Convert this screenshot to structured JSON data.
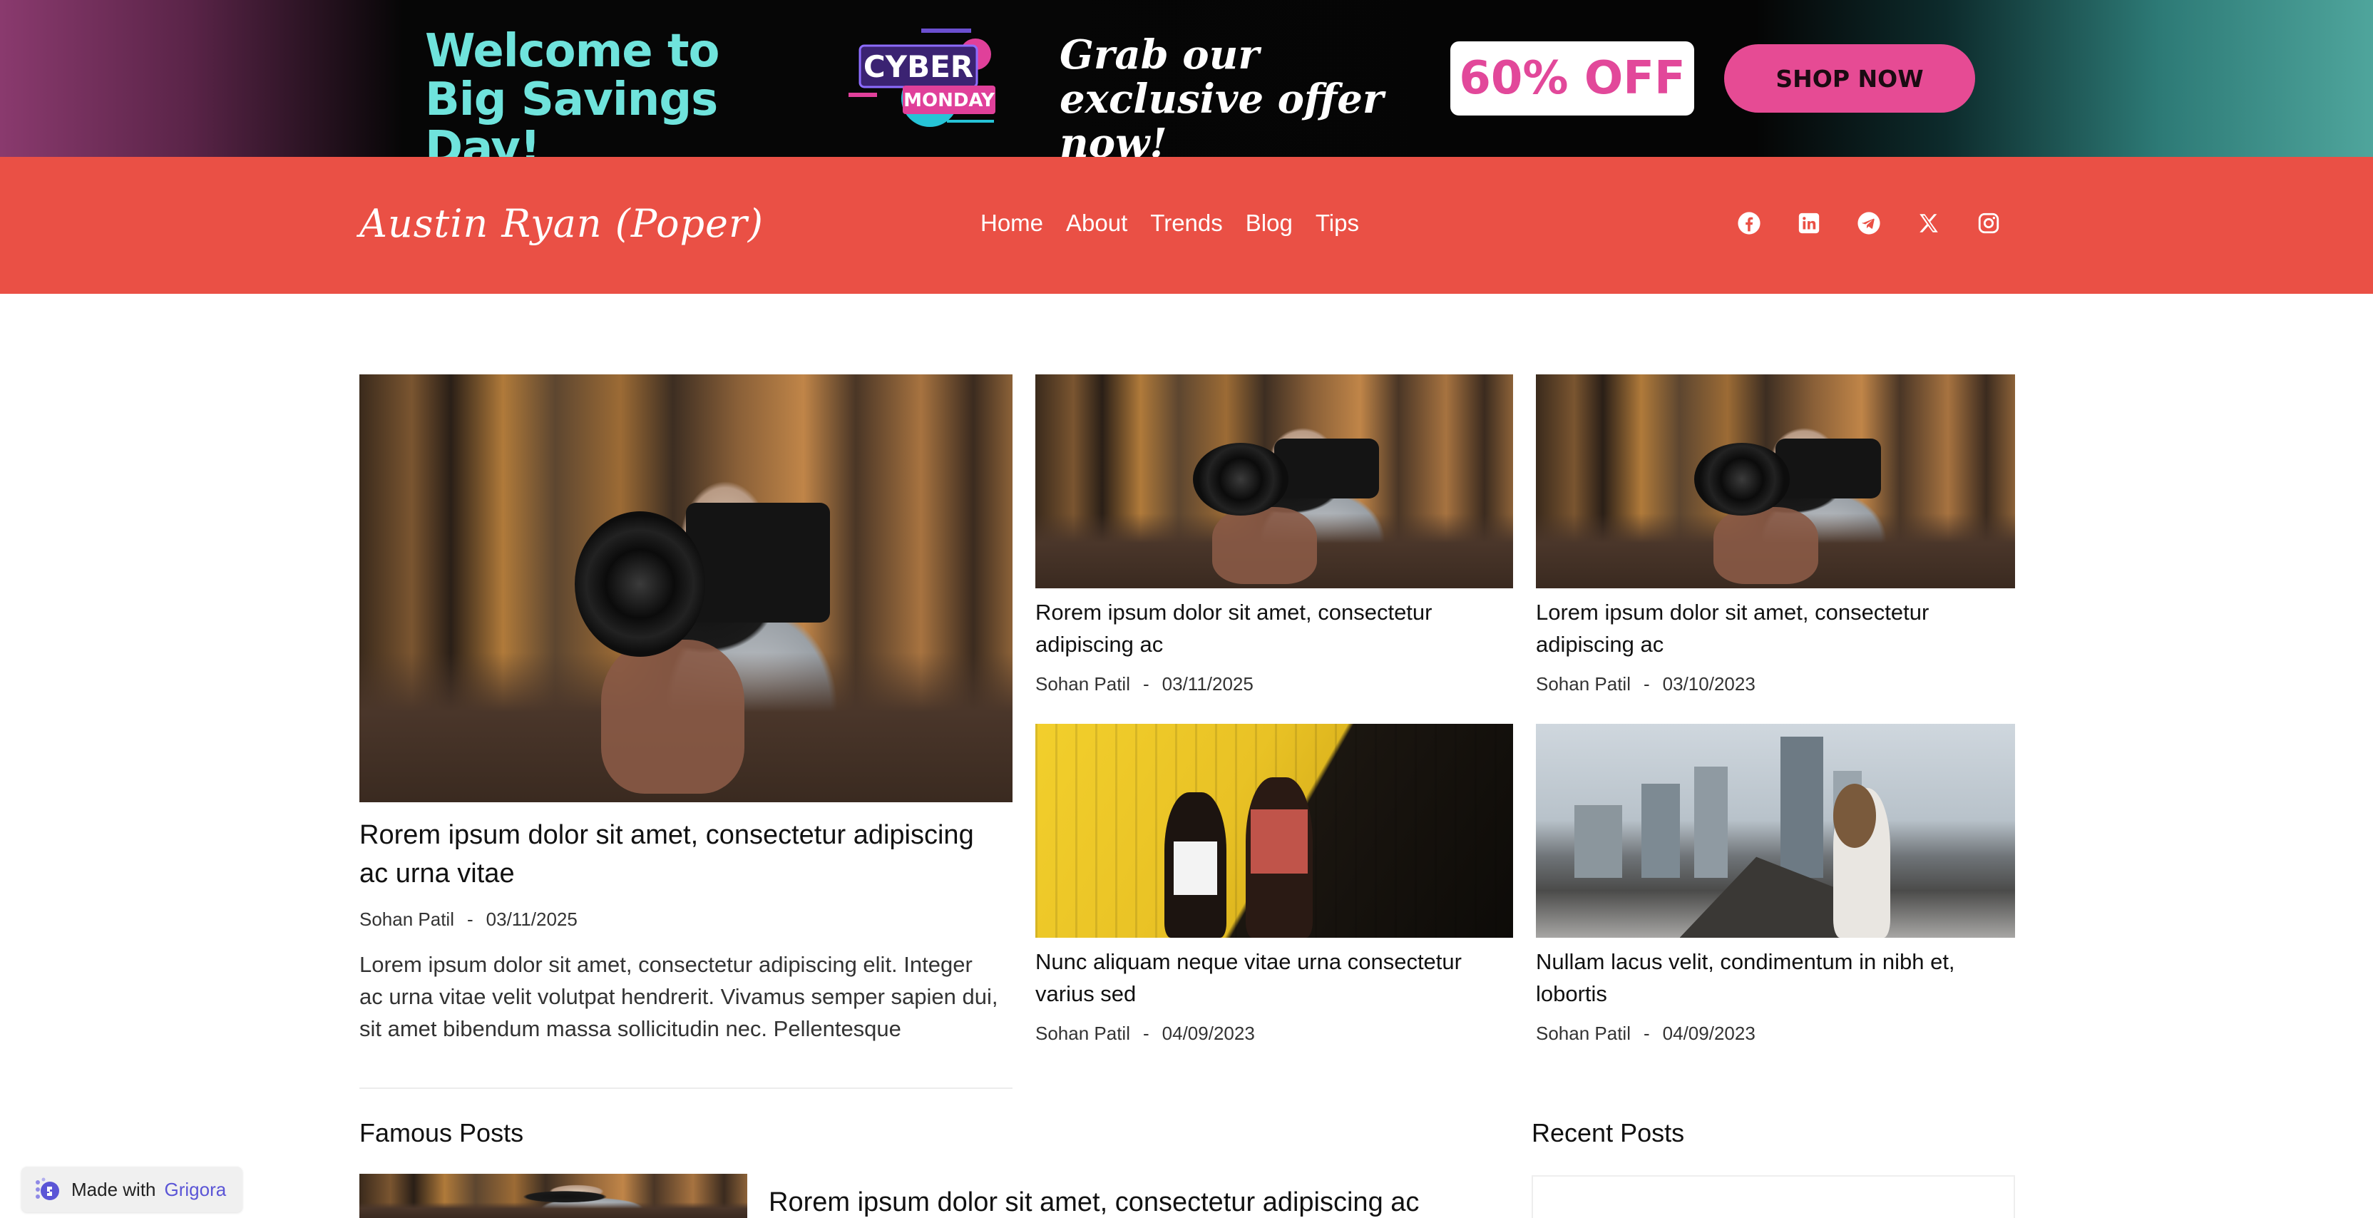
{
  "promo": {
    "headline": "Welcome to Big Savings Day!",
    "badge_top": "CYBER",
    "badge_bottom": "MONDAY",
    "offer": "Grab our exclusive offer now!",
    "discount": "60% OFF",
    "cta": "SHOP NOW",
    "colors": {
      "headline": "#6fe3dc",
      "cta_bg": "#e64b94",
      "discount_text": "#e2489a"
    }
  },
  "header": {
    "brand": "Austin Ryan (Poper)",
    "nav": [
      "Home",
      "About",
      "Trends",
      "Blog",
      "Tips"
    ],
    "socials": [
      "facebook-icon",
      "linkedin-icon",
      "telegram-icon",
      "x-icon",
      "instagram-icon"
    ],
    "background": "#ea5045"
  },
  "featured": {
    "title": "Rorem ipsum dolor sit amet, consectetur adipiscing ac urna vitae",
    "author": "Sohan Patil",
    "date": "03/11/2025",
    "excerpt": "Lorem ipsum dolor sit amet, consectetur adipiscing elit. Integer ac urna vitae velit volutpat hendrerit. Vivamus semper sapien dui, sit amet bibendum massa sollicitudin nec. Pellentesque"
  },
  "cards": [
    {
      "title": "Rorem ipsum dolor sit amet, consectetur adipiscing ac",
      "author": "Sohan Patil",
      "date": "03/11/2025"
    },
    {
      "title": "Lorem ipsum dolor sit amet, consectetur adipiscing ac",
      "author": "Sohan Patil",
      "date": "03/10/2023"
    },
    {
      "title": "Nunc aliquam neque vitae urna consectetur varius sed",
      "author": "Sohan Patil",
      "date": "04/09/2023"
    },
    {
      "title": "Nullam lacus velit, condimentum in nibh et, lobortis",
      "author": "Sohan Patil",
      "date": "04/09/2023"
    }
  ],
  "sections": {
    "famous": "Famous Posts",
    "famous_first_title": "Rorem ipsum dolor sit amet, consectetur adipiscing ac",
    "recent": "Recent Posts"
  },
  "footer_badge": {
    "prefix": "Made with",
    "brand": "Grigora"
  }
}
